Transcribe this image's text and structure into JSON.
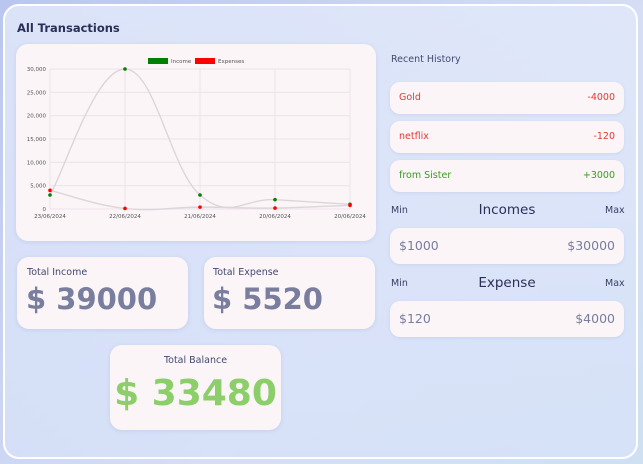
{
  "page": {
    "title": "All Transactions"
  },
  "colors": {
    "income": "#008000",
    "expense": "#ff0000",
    "income_text": "#3a9d1e",
    "expense_text": "#e53935",
    "balance": "#8ccf6a"
  },
  "chart_data": {
    "type": "line",
    "title": "",
    "xlabel": "",
    "ylabel": "",
    "categories": [
      "23/06/2024",
      "22/06/2024",
      "21/06/2024",
      "20/06/2024",
      "20/06/2024"
    ],
    "y_ticks": [
      "0",
      "5,000",
      "10,000",
      "15,000",
      "20,000",
      "25,000",
      "30,000"
    ],
    "ylim": [
      0,
      30000
    ],
    "grid": true,
    "legend_position": "top",
    "series": [
      {
        "name": "Income",
        "color": "#008000",
        "values": [
          3000,
          30000,
          3000,
          2000,
          1000
        ]
      },
      {
        "name": "Expenses",
        "color": "#ff0000",
        "values": [
          4000,
          120,
          400,
          200,
          800
        ]
      }
    ]
  },
  "stats": {
    "total_income": {
      "label": "Total Income",
      "value": "$ 39000"
    },
    "total_expense": {
      "label": "Total Expense",
      "value": "$ 5520"
    },
    "total_balance": {
      "label": "Total Balance",
      "value": "$ 33480"
    }
  },
  "history": {
    "label": "Recent History",
    "items": [
      {
        "name": "Gold",
        "amount": "-4000",
        "type": "expense"
      },
      {
        "name": "netflix",
        "amount": "-120",
        "type": "expense"
      },
      {
        "name": "from Sister",
        "amount": "+3000",
        "type": "income"
      }
    ]
  },
  "incomes_range": {
    "title": "Incomes",
    "min_label": "Min",
    "max_label": "Max",
    "min": "$1000",
    "max": "$30000"
  },
  "expense_range": {
    "title": "Expense",
    "min_label": "Min",
    "max_label": "Max",
    "min": "$120",
    "max": "$4000"
  }
}
